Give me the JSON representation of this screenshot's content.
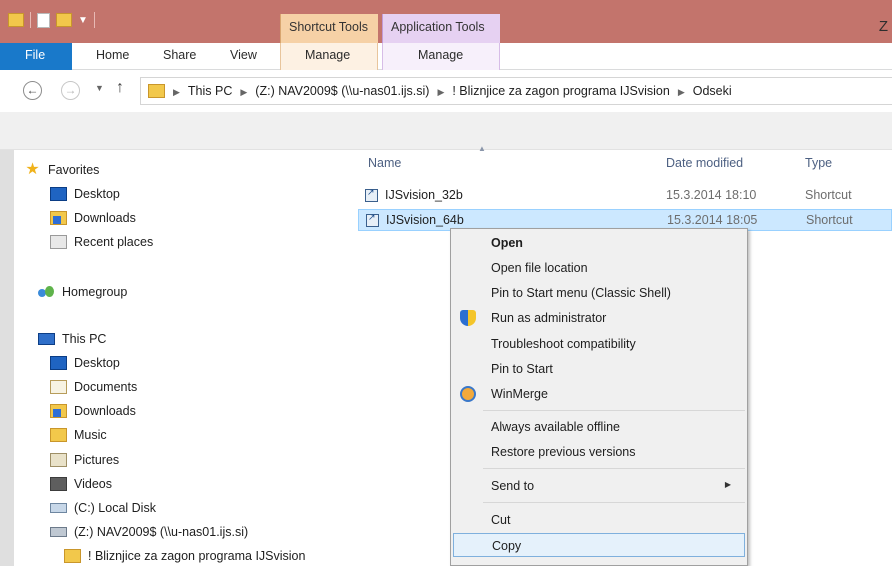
{
  "titlebar": {
    "context_tabs": [
      "Shortcut Tools",
      "Application Tools"
    ],
    "title_letter": "Z"
  },
  "ribbon": {
    "file_label": "File",
    "tabs": [
      "Home",
      "Share",
      "View"
    ],
    "shortcut_manage": "Manage",
    "application_manage": "Manage"
  },
  "address": {
    "breadcrumbs": [
      "This PC",
      "(Z:) NAV2009$ (\\\\u-nas01.ijs.si)",
      "! Bliznjice za zagon programa IJSvision",
      "Odseki"
    ]
  },
  "nav": {
    "favorites": "Favorites",
    "fav_items": [
      "Desktop",
      "Downloads",
      "Recent places"
    ],
    "homegroup": "Homegroup",
    "thispc": "This PC",
    "pc_items": [
      "Desktop",
      "Documents",
      "Downloads",
      "Music",
      "Pictures",
      "Videos",
      "(C:) Local Disk",
      "(Z:) NAV2009$ (\\\\u-nas01.ijs.si)",
      "! Bliznjice za zagon programa IJSvision"
    ]
  },
  "files": {
    "columns": [
      "Name",
      "Date modified",
      "Type"
    ],
    "rows": [
      {
        "name": "IJSvision_32b",
        "date": "15.3.2014 18:10",
        "type": "Shortcut"
      },
      {
        "name": "IJSvision_64b",
        "date": "15.3.2014 18:05",
        "type": "Shortcut"
      }
    ]
  },
  "context_menu": {
    "items": [
      "Open",
      "Open file location",
      "Pin to Start menu (Classic Shell)",
      "Run as administrator",
      "Troubleshoot compatibility",
      "Pin to Start",
      "WinMerge",
      "Always available offline",
      "Restore previous versions",
      "Send to",
      "Cut",
      "Copy"
    ]
  },
  "colors": {
    "titlebar": "#c3746c",
    "file_tab": "#1979ca",
    "selection": "#cce8ff",
    "menu_highlight": "#e5f1fb"
  }
}
